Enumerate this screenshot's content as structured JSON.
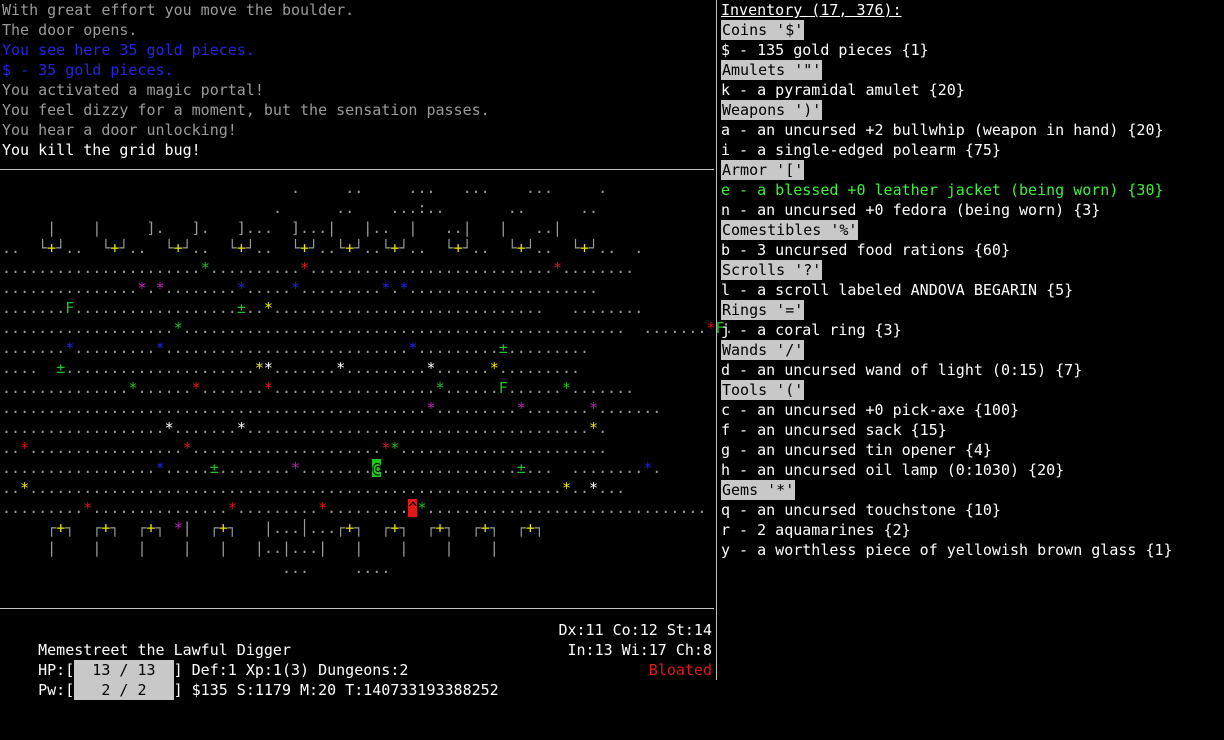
{
  "messages": [
    {
      "text": "With great effort you move the boulder.",
      "color": "gray"
    },
    {
      "text": "The door opens.",
      "color": "gray"
    },
    {
      "text": "You see here 35 gold pieces.",
      "color": "blue"
    },
    {
      "text": "$ - 35 gold pieces.",
      "color": "blue"
    },
    {
      "text": "You activated a magic portal!",
      "color": "gray"
    },
    {
      "text": "You feel dizzy for a moment, but the sensation passes.",
      "color": "gray"
    },
    {
      "text": "You hear a door unlocking!",
      "color": "gray"
    },
    {
      "text": "You kill the grid bug!",
      "color": "white"
    }
  ],
  "map_rows": [
    "                                .     ..     ...   ...    ...     .",
    "                              .      ..    ...:..       ..      ..",
    "     |    |     ].   ].   ]...  ]...|   |..  |   ..|   |   ..|",
    "..  └+┘..  └+┘..  └+┘..  └+┘..  └+┘..└+┘..└+┘..  └+┘..  └+┘..  └+┘..  .",
    "......................*..........*...........................*........",
    "...............*.*........*.....*.........*.*.....................",
    ".......F..................±..*..............................   ........",
    "...................*.................................................  .......*F.",
    ".......*.........*...........................*.........±.........",
    "....  ±.....................**.......*.........*......*.........",
    "..............*......*.......*..................*......F......*.......",
    "...............................................*.........*.......*.......",
    "..................*.......*......................................*.",
    "..*.................*.....................**.......................",
    ".................*.....±........*........@...............±...  ........*.",
    "..*...........................................................*..*...",
    ".........*...............*.........*.........^*...............................",
    "     ┌+┐  ┌+┐  ┌+┐ *|  ┌+┐   |...│...┌+┐  ┌+┐  ┌+┐  ┌+┐  ┌+┐",
    "     |    |    |    |   |   |..|...|   |    |    |    |",
    "                               ...     ...."
  ],
  "status": {
    "name_line": "Memestreet the Lawful Digger",
    "attrs_1": "Dx:11 Co:12 St:14",
    "hp_label": "HP:[",
    "hp_value": "  13 / 13  ",
    "hp_rest": "] Def:1 Xp:1(3) Dungeons:2",
    "attrs_2": "In:13 Wi:17 Ch:8",
    "pw_label": "Pw:[",
    "pw_value": "   2 / 2   ",
    "pw_rest": "] $135 S:1179 M:20 T:140733193388252",
    "condition": "Bloated",
    "condition_color": "#e01818",
    "hp_fraction": 1.0,
    "pw_fraction": 1.0
  },
  "inventory": {
    "title": "Inventory (17, 376):",
    "categories": [
      {
        "name": "Coins '$'",
        "items": [
          {
            "text": "$ - 135 gold pieces {1}"
          }
        ]
      },
      {
        "name": "Amulets '\"'",
        "items": [
          {
            "text": "k - a pyramidal amulet {20}"
          }
        ]
      },
      {
        "name": "Weapons ')'",
        "items": [
          {
            "text": "a - an uncursed +2 bullwhip (weapon in hand) {20}"
          },
          {
            "text": "i - a single-edged polearm {75}"
          }
        ]
      },
      {
        "name": "Armor '['",
        "items": [
          {
            "text": "e - a blessed +0 leather jacket (being worn) {30}",
            "color": "#3cf03c"
          },
          {
            "text": "n - an uncursed +0 fedora (being worn) {3}"
          }
        ]
      },
      {
        "name": "Comestibles '%'",
        "items": [
          {
            "text": "b - 3 uncursed food rations {60}"
          }
        ]
      },
      {
        "name": "Scrolls '?'",
        "items": [
          {
            "text": "l - a scroll labeled ANDOVA BEGARIN {5}"
          }
        ]
      },
      {
        "name": "Rings '='",
        "items": [
          {
            "text": "j - a coral ring {3}"
          }
        ]
      },
      {
        "name": "Wands '/'",
        "items": [
          {
            "text": "d - an uncursed wand of light (0:15) {7}"
          }
        ]
      },
      {
        "name": "Tools '('",
        "items": [
          {
            "text": "c - an uncursed +0 pick-axe {100}"
          },
          {
            "text": "f - an uncursed sack {15}"
          },
          {
            "text": "g - an uncursed tin opener {4}"
          },
          {
            "text": "h - an uncursed oil lamp (0:1030) {20}"
          }
        ]
      },
      {
        "name": "Gems '*'",
        "items": [
          {
            "text": "q - an uncursed touchstone {10}"
          },
          {
            "text": "r - 2 aquamarines {2}"
          },
          {
            "text": "y - a worthless piece of yellowish brown glass {1}"
          }
        ]
      }
    ]
  }
}
